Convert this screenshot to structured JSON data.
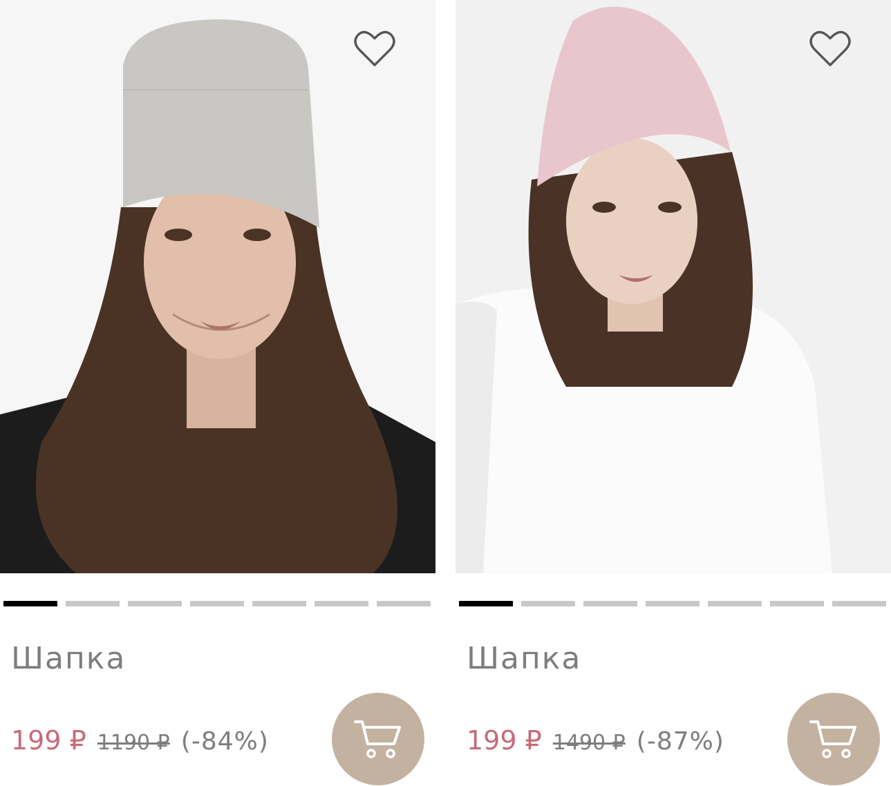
{
  "products": [
    {
      "title": "Шапка",
      "price_current": "199 ₽",
      "price_old": "1190 ₽",
      "discount": "(-84%)",
      "image_slides": 7,
      "active_slide": 0,
      "favorite_icon": "heart-outline-icon",
      "cart_icon": "cart-icon",
      "hat_color": "#c9c7c3"
    },
    {
      "title": "Шапка",
      "price_current": "199 ₽",
      "price_old": "1490 ₽",
      "discount": "(-87%)",
      "image_slides": 7,
      "active_slide": 0,
      "favorite_icon": "heart-outline-icon",
      "cart_icon": "cart-icon",
      "hat_color": "#e9c6cd"
    }
  ],
  "colors": {
    "price_current": "#c66b78",
    "muted_text": "#7d7d7d",
    "cart_button": "#c4b2a0",
    "indicator_active": "#000000",
    "indicator_inactive": "#c8c8c8"
  }
}
